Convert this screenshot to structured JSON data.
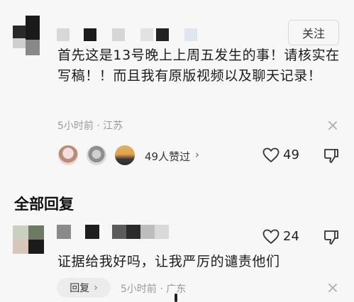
{
  "comment": {
    "follow_label": "关注",
    "text": "首先这是13号晚上上周五发生的事！请核实在写稿！！而且我有原版视频以及聊天记录！",
    "time": "5小时前",
    "location": "江苏",
    "likers_text": "49人赞过",
    "like_count": "49"
  },
  "replies_section": {
    "title": "全部回复"
  },
  "reply": {
    "text": "证据给我好吗，让我严厉的谴责他们",
    "like_count": "24",
    "reply_label": "回复",
    "time": "5小时前",
    "location": "广东"
  },
  "icons": {
    "like": "heart-outline-icon",
    "dislike": "thumb-down-icon",
    "close": "close-icon",
    "chevron": "chevron-right-icon"
  },
  "colors": {
    "background": "#f7f7f7",
    "meta_text": "#9a9a9a",
    "chip_bg": "#ececec"
  }
}
